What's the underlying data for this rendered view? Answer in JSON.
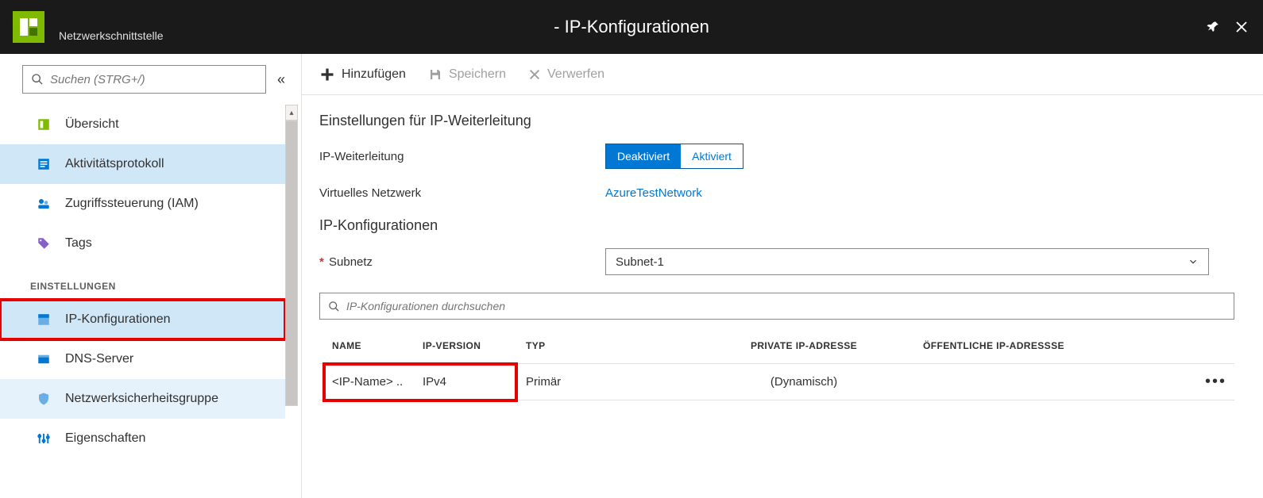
{
  "topbar": {
    "title": "- IP-Konfigurationen",
    "subtitle": "Netzwerkschnittstelle"
  },
  "sidebar": {
    "search_placeholder": "Suchen (STRG+/)",
    "items": [
      {
        "label": "Übersicht"
      },
      {
        "label": "Aktivitätsprotokoll"
      },
      {
        "label": "Zugriffssteuerung (IAM)"
      },
      {
        "label": "Tags"
      }
    ],
    "section_label": "EINSTELLUNGEN",
    "settings_items": [
      {
        "label": "IP-Konfigurationen"
      },
      {
        "label": "DNS-Server"
      },
      {
        "label": "Netzwerksicherheitsgruppe"
      },
      {
        "label": "Eigenschaften"
      }
    ]
  },
  "toolbar": {
    "add": "Hinzufügen",
    "save": "Speichern",
    "discard": "Verwerfen"
  },
  "content": {
    "ipfwd_heading": "Einstellungen für IP-Weiterleitung",
    "ipfwd_label": "IP-Weiterleitung",
    "toggle_off": "Deaktiviert",
    "toggle_on": "Aktiviert",
    "vnet_label": "Virtuelles Netzwerk",
    "vnet_value": "AzureTestNetwork",
    "ipconf_heading": "IP-Konfigurationen",
    "subnet_label": "Subnetz",
    "subnet_value": "Subnet-1",
    "filter_placeholder": "IP-Konfigurationen durchsuchen",
    "columns": {
      "name": "NAME",
      "ipv": "IP-VERSION",
      "typ": "TYP",
      "priv": "PRIVATE IP-ADRESSE",
      "pub": "ÖFFENTLICHE IP-ADRESSSE"
    },
    "rows": [
      {
        "name": "<IP-Name> ..",
        "ipv": "IPv4",
        "typ": "Primär",
        "priv": "(Dynamisch)",
        "pub": ""
      }
    ]
  }
}
